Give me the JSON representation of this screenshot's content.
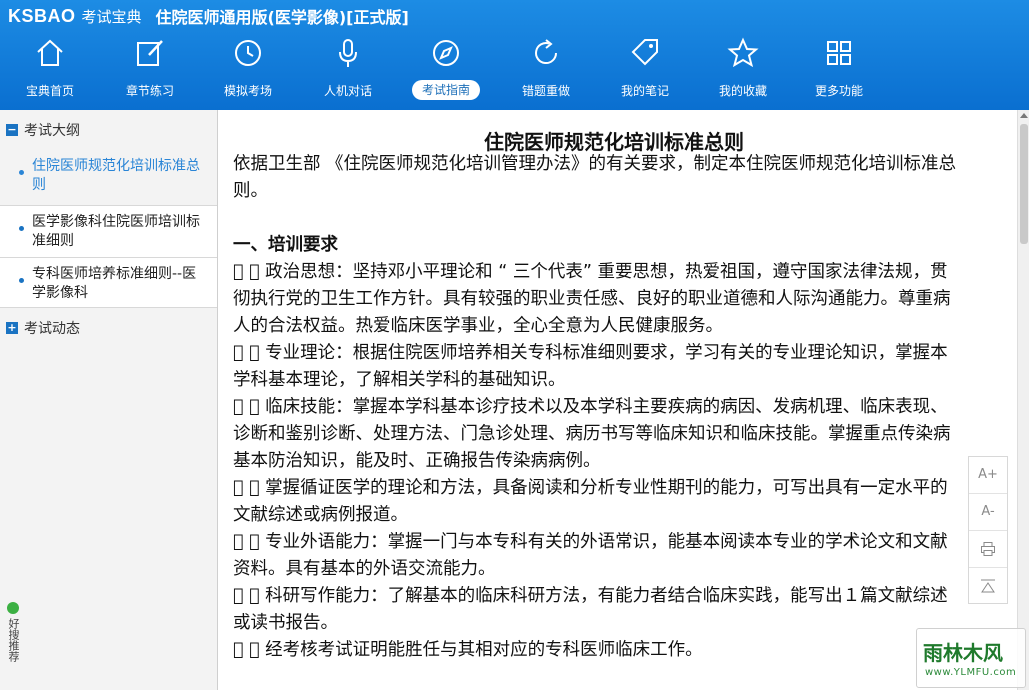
{
  "header": {
    "logo": "KSBAO",
    "logo_cn": "考试宝典",
    "title": "住院医师通用版(医学影像)[正式版]"
  },
  "toolbar": [
    {
      "label": "宝典首页",
      "icon": "home-icon"
    },
    {
      "label": "章节练习",
      "icon": "edit-icon"
    },
    {
      "label": "模拟考场",
      "icon": "clock-icon"
    },
    {
      "label": "人机对话",
      "icon": "microphone-icon"
    },
    {
      "label": "考试指南",
      "icon": "compass-icon",
      "active": true
    },
    {
      "label": "错题重做",
      "icon": "refresh-icon"
    },
    {
      "label": "我的笔记",
      "icon": "tag-icon"
    },
    {
      "label": "我的收藏",
      "icon": "star-icon"
    },
    {
      "label": "更多功能",
      "icon": "grid-icon"
    }
  ],
  "sidebar": {
    "group1": {
      "label": "考试大纲",
      "toggle": "−"
    },
    "items": [
      "住院医师规范化培训标准总则",
      "医学影像科住院医师培训标准细则",
      "专科医师培养标准细则--医学影像科"
    ],
    "group2": {
      "label": "考试动态",
      "toggle": "+"
    },
    "widget": "好搜推荐"
  },
  "document": {
    "title": "住院医师规范化培训标准总则",
    "intro": "依据卫生部 《住院医师规范化培训管理办法》的有关要求，制定本住院医师规范化培训标准总则。",
    "section1": "一、培训要求",
    "paras": [
      "１ 􏿾 政治思想：坚持邓小平理论和 “ 三个代表” 重要思想，热爱祖国，遵守国家法律法规，贯彻执行党的卫生工作方针。具有较强的职业责任感、良好的职业道德和人际沟通能力。尊重病人的合法权益。热爱临床医学事业，全心全意为人民健康服务。",
      "２ 􏿾 专业理论：根据住院医师培养相关专科标准细则要求，学习有关的专业理论知识，掌握本学科基本理论，了解相关学科的基础知识。",
      "３ 􏿾 临床技能：掌握本学科基本诊疗技术以及本学科主要疾病的病因、发病机理、临床表现、诊断和鉴别诊断、处理方法、门急诊处理、病历书写等临床知识和临床技能。掌握重点传染病基本防治知识，能及时、正确报告传染病病例。",
      "４ 􏿾 掌握循证医学的理论和方法，具备阅读和分析专业性期刊的能力，可写出具有一定水平的文献综述或病例报道。",
      "５ 􏿾 专业外语能力：掌握一门与本专科有关的外语常识，能基本阅读本专业的学术论文和文献资料。具有基本的外语交流能力。",
      "６ 􏿾 科研写作能力：了解基本的临床科研方法，有能力者结合临床实践，能写出１篇文献综述或读书报告。",
      "７ 􏿾 经考核考试证明能胜任与其相对应的专科医师临床工作。"
    ]
  },
  "float_tools": {
    "font_up": "A+",
    "font_down": "A-",
    "print": "print-icon",
    "top": "back-to-top-icon"
  },
  "watermark": {
    "main": "雨林木风",
    "sub": "www.YLMFU.com"
  }
}
